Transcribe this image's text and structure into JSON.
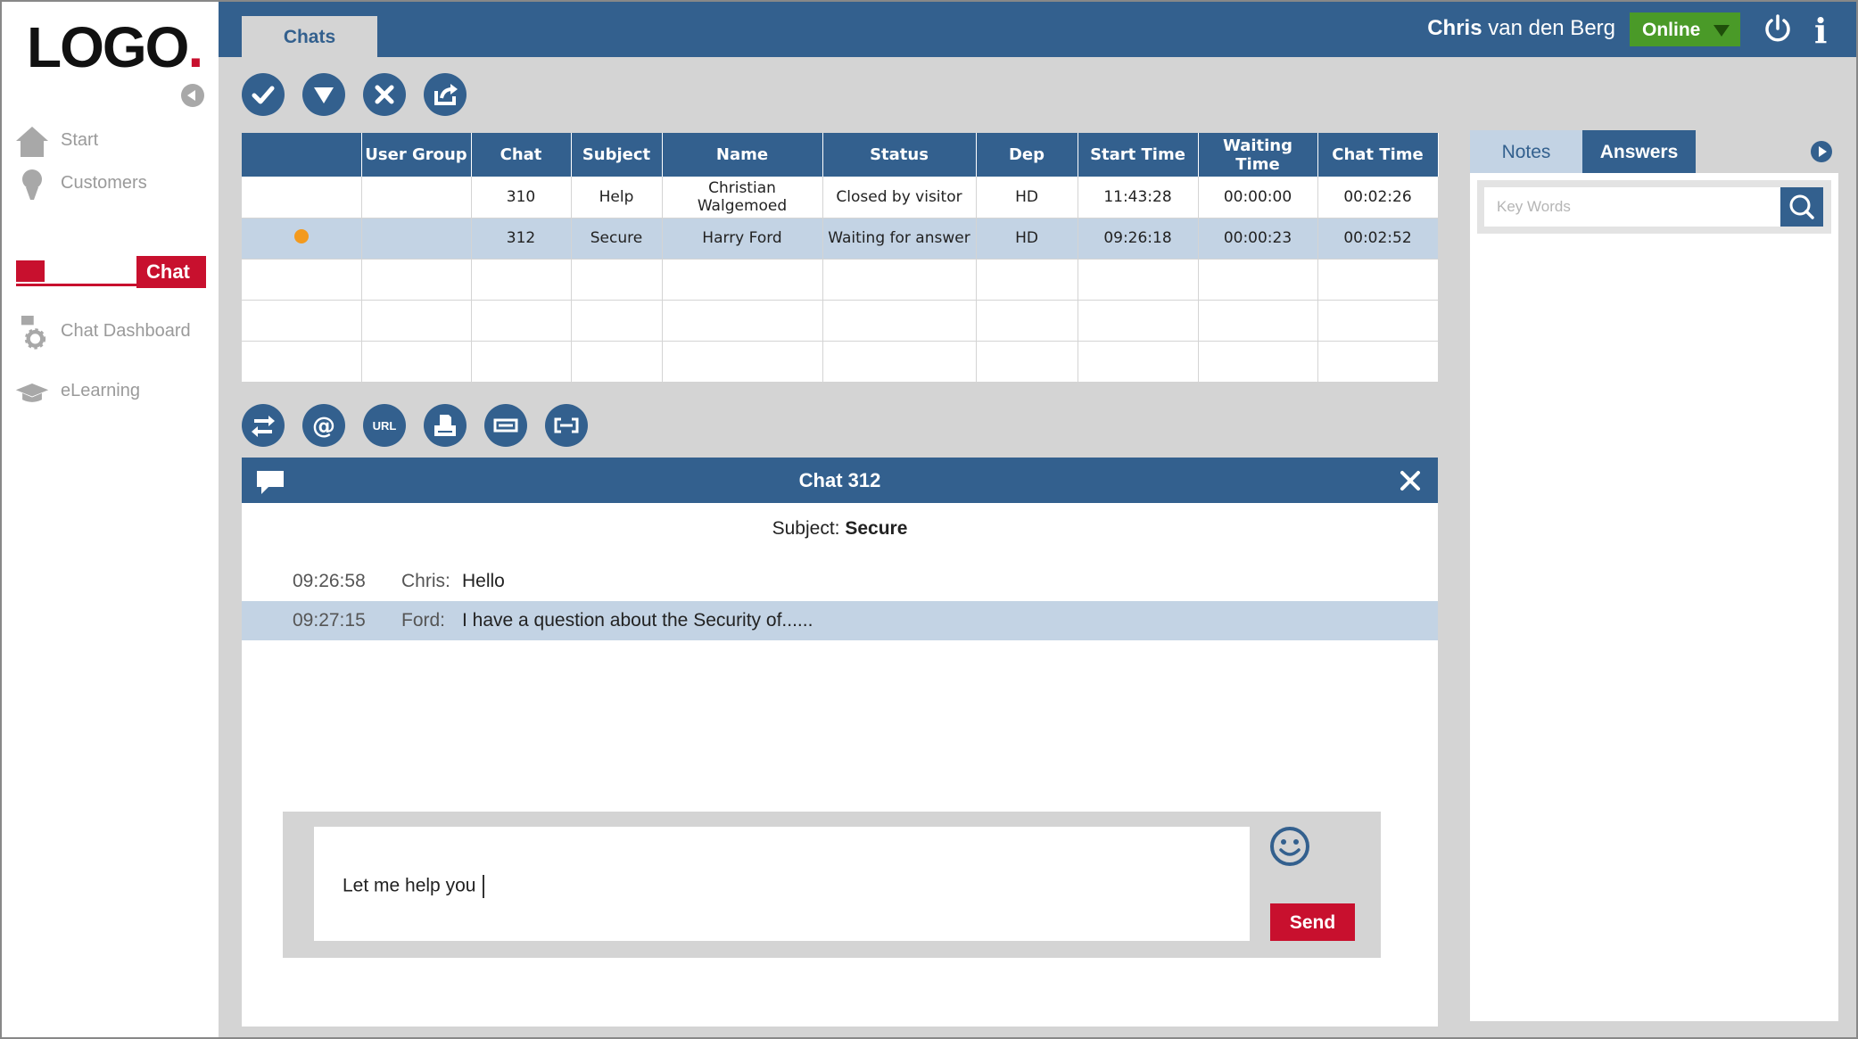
{
  "logo": {
    "text": "LOGO",
    "dot": "."
  },
  "sidebar": {
    "items": [
      {
        "label": "Start",
        "icon": "home-icon"
      },
      {
        "label": "Customers",
        "icon": "user-icon"
      },
      {
        "label": "Chat",
        "icon": "chat-icon",
        "active": true
      },
      {
        "label": "Chat Dashboard",
        "icon": "chat-gear-icon"
      },
      {
        "label": "eLearning",
        "icon": "graduation-cap-icon"
      }
    ]
  },
  "header": {
    "tab_label": "Chats",
    "user_first": "Chris",
    "user_rest": " van den Berg",
    "status": "Online",
    "info": "i"
  },
  "toolbar": {
    "icons": [
      "check-icon",
      "filter-icon",
      "close-icon",
      "forward-icon"
    ]
  },
  "table": {
    "columns": [
      "",
      "User Group",
      "Chat",
      "Subject",
      "Name",
      "Status",
      "Dep",
      "Start Time",
      "Waiting Time",
      "Chat Time"
    ],
    "rows": [
      {
        "indicator": "",
        "user_group": "",
        "chat": "310",
        "subject": "Help",
        "name": "Christian Walgemoed",
        "status": "Closed by visitor",
        "dep": "HD",
        "start": "11:43:28",
        "waiting": "00:00:00",
        "chat_time": "00:02:26"
      },
      {
        "indicator": "dot",
        "user_group": "",
        "chat": "312",
        "subject": "Secure",
        "name": "Harry Ford",
        "status": "Waiting for answer",
        "dep": "HD",
        "start": "09:26:18",
        "waiting": "00:00:23",
        "chat_time": "00:02:52"
      }
    ]
  },
  "chat_tools": {
    "icons": [
      "transfer-icon",
      "email-icon",
      "url-icon",
      "print-icon",
      "collapse-icon",
      "expand-icon"
    ],
    "url_label": "URL"
  },
  "chat": {
    "title": "Chat 312",
    "subject_label": "Subject:",
    "subject_value": "Secure",
    "messages": [
      {
        "time": "09:26:58",
        "sender": "Chris:",
        "text": "Hello"
      },
      {
        "time": "09:27:15",
        "sender": "Ford:",
        "text": "I have a question about the Security of......"
      }
    ],
    "compose_text": "Let me help you",
    "send_label": "Send"
  },
  "right_panel": {
    "tab_notes": "Notes",
    "tab_answers": "Answers",
    "search_placeholder": "Key Words"
  },
  "colors": {
    "primary": "#33608e",
    "accent_red": "#c8102e",
    "online_green": "#4a9a28",
    "selected_row": "#c3d3e4",
    "unread_dot": "#f39a1e"
  }
}
